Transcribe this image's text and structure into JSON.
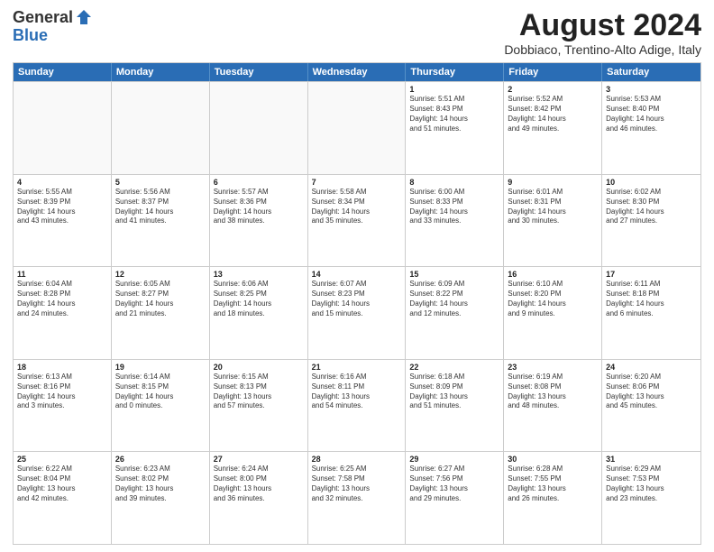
{
  "logo": {
    "general": "General",
    "blue": "Blue"
  },
  "title": "August 2024",
  "subtitle": "Dobbiaco, Trentino-Alto Adige, Italy",
  "days": [
    "Sunday",
    "Monday",
    "Tuesday",
    "Wednesday",
    "Thursday",
    "Friday",
    "Saturday"
  ],
  "rows": [
    [
      {
        "day": "",
        "text": "",
        "empty": true
      },
      {
        "day": "",
        "text": "",
        "empty": true
      },
      {
        "day": "",
        "text": "",
        "empty": true
      },
      {
        "day": "",
        "text": "",
        "empty": true
      },
      {
        "day": "1",
        "text": "Sunrise: 5:51 AM\nSunset: 8:43 PM\nDaylight: 14 hours\nand 51 minutes.",
        "empty": false
      },
      {
        "day": "2",
        "text": "Sunrise: 5:52 AM\nSunset: 8:42 PM\nDaylight: 14 hours\nand 49 minutes.",
        "empty": false
      },
      {
        "day": "3",
        "text": "Sunrise: 5:53 AM\nSunset: 8:40 PM\nDaylight: 14 hours\nand 46 minutes.",
        "empty": false
      }
    ],
    [
      {
        "day": "4",
        "text": "Sunrise: 5:55 AM\nSunset: 8:39 PM\nDaylight: 14 hours\nand 43 minutes.",
        "empty": false
      },
      {
        "day": "5",
        "text": "Sunrise: 5:56 AM\nSunset: 8:37 PM\nDaylight: 14 hours\nand 41 minutes.",
        "empty": false
      },
      {
        "day": "6",
        "text": "Sunrise: 5:57 AM\nSunset: 8:36 PM\nDaylight: 14 hours\nand 38 minutes.",
        "empty": false
      },
      {
        "day": "7",
        "text": "Sunrise: 5:58 AM\nSunset: 8:34 PM\nDaylight: 14 hours\nand 35 minutes.",
        "empty": false
      },
      {
        "day": "8",
        "text": "Sunrise: 6:00 AM\nSunset: 8:33 PM\nDaylight: 14 hours\nand 33 minutes.",
        "empty": false
      },
      {
        "day": "9",
        "text": "Sunrise: 6:01 AM\nSunset: 8:31 PM\nDaylight: 14 hours\nand 30 minutes.",
        "empty": false
      },
      {
        "day": "10",
        "text": "Sunrise: 6:02 AM\nSunset: 8:30 PM\nDaylight: 14 hours\nand 27 minutes.",
        "empty": false
      }
    ],
    [
      {
        "day": "11",
        "text": "Sunrise: 6:04 AM\nSunset: 8:28 PM\nDaylight: 14 hours\nand 24 minutes.",
        "empty": false
      },
      {
        "day": "12",
        "text": "Sunrise: 6:05 AM\nSunset: 8:27 PM\nDaylight: 14 hours\nand 21 minutes.",
        "empty": false
      },
      {
        "day": "13",
        "text": "Sunrise: 6:06 AM\nSunset: 8:25 PM\nDaylight: 14 hours\nand 18 minutes.",
        "empty": false
      },
      {
        "day": "14",
        "text": "Sunrise: 6:07 AM\nSunset: 8:23 PM\nDaylight: 14 hours\nand 15 minutes.",
        "empty": false
      },
      {
        "day": "15",
        "text": "Sunrise: 6:09 AM\nSunset: 8:22 PM\nDaylight: 14 hours\nand 12 minutes.",
        "empty": false
      },
      {
        "day": "16",
        "text": "Sunrise: 6:10 AM\nSunset: 8:20 PM\nDaylight: 14 hours\nand 9 minutes.",
        "empty": false
      },
      {
        "day": "17",
        "text": "Sunrise: 6:11 AM\nSunset: 8:18 PM\nDaylight: 14 hours\nand 6 minutes.",
        "empty": false
      }
    ],
    [
      {
        "day": "18",
        "text": "Sunrise: 6:13 AM\nSunset: 8:16 PM\nDaylight: 14 hours\nand 3 minutes.",
        "empty": false
      },
      {
        "day": "19",
        "text": "Sunrise: 6:14 AM\nSunset: 8:15 PM\nDaylight: 14 hours\nand 0 minutes.",
        "empty": false
      },
      {
        "day": "20",
        "text": "Sunrise: 6:15 AM\nSunset: 8:13 PM\nDaylight: 13 hours\nand 57 minutes.",
        "empty": false
      },
      {
        "day": "21",
        "text": "Sunrise: 6:16 AM\nSunset: 8:11 PM\nDaylight: 13 hours\nand 54 minutes.",
        "empty": false
      },
      {
        "day": "22",
        "text": "Sunrise: 6:18 AM\nSunset: 8:09 PM\nDaylight: 13 hours\nand 51 minutes.",
        "empty": false
      },
      {
        "day": "23",
        "text": "Sunrise: 6:19 AM\nSunset: 8:08 PM\nDaylight: 13 hours\nand 48 minutes.",
        "empty": false
      },
      {
        "day": "24",
        "text": "Sunrise: 6:20 AM\nSunset: 8:06 PM\nDaylight: 13 hours\nand 45 minutes.",
        "empty": false
      }
    ],
    [
      {
        "day": "25",
        "text": "Sunrise: 6:22 AM\nSunset: 8:04 PM\nDaylight: 13 hours\nand 42 minutes.",
        "empty": false
      },
      {
        "day": "26",
        "text": "Sunrise: 6:23 AM\nSunset: 8:02 PM\nDaylight: 13 hours\nand 39 minutes.",
        "empty": false
      },
      {
        "day": "27",
        "text": "Sunrise: 6:24 AM\nSunset: 8:00 PM\nDaylight: 13 hours\nand 36 minutes.",
        "empty": false
      },
      {
        "day": "28",
        "text": "Sunrise: 6:25 AM\nSunset: 7:58 PM\nDaylight: 13 hours\nand 32 minutes.",
        "empty": false
      },
      {
        "day": "29",
        "text": "Sunrise: 6:27 AM\nSunset: 7:56 PM\nDaylight: 13 hours\nand 29 minutes.",
        "empty": false
      },
      {
        "day": "30",
        "text": "Sunrise: 6:28 AM\nSunset: 7:55 PM\nDaylight: 13 hours\nand 26 minutes.",
        "empty": false
      },
      {
        "day": "31",
        "text": "Sunrise: 6:29 AM\nSunset: 7:53 PM\nDaylight: 13 hours\nand 23 minutes.",
        "empty": false
      }
    ]
  ]
}
